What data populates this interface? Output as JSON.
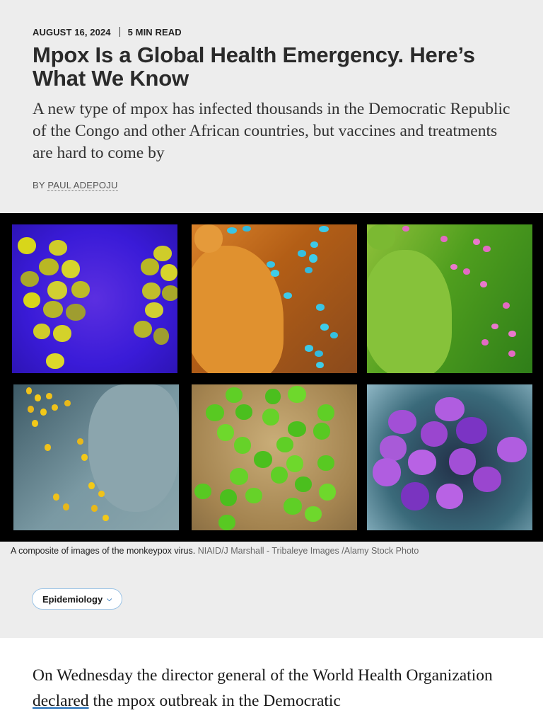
{
  "article": {
    "date": "AUGUST 16, 2024",
    "read_time": "5 MIN READ",
    "headline": "Mpox Is a Global Health Emergency. Here’s What We Know",
    "dek": "A new type of mpox has infected thousands in the Democratic Republic of the Congo and other African countries, but vaccines and treatments are hard to come by",
    "byline_prefix": "BY",
    "author": "PAUL ADEPOJU"
  },
  "figure": {
    "caption": "A composite of images of the monkeypox virus.",
    "credit": "NIAID/J Marshall - Tribaleye Images /Alamy Stock Photo"
  },
  "tag": {
    "label": "Epidemiology",
    "icon": "chevron-down-icon",
    "accent_color": "#1f6bb5"
  },
  "body": {
    "before_link": "On Wednesday the director general of the World Health Organization ",
    "link_text": "declared",
    "after_link": " the mpox outbreak in the Democratic"
  }
}
